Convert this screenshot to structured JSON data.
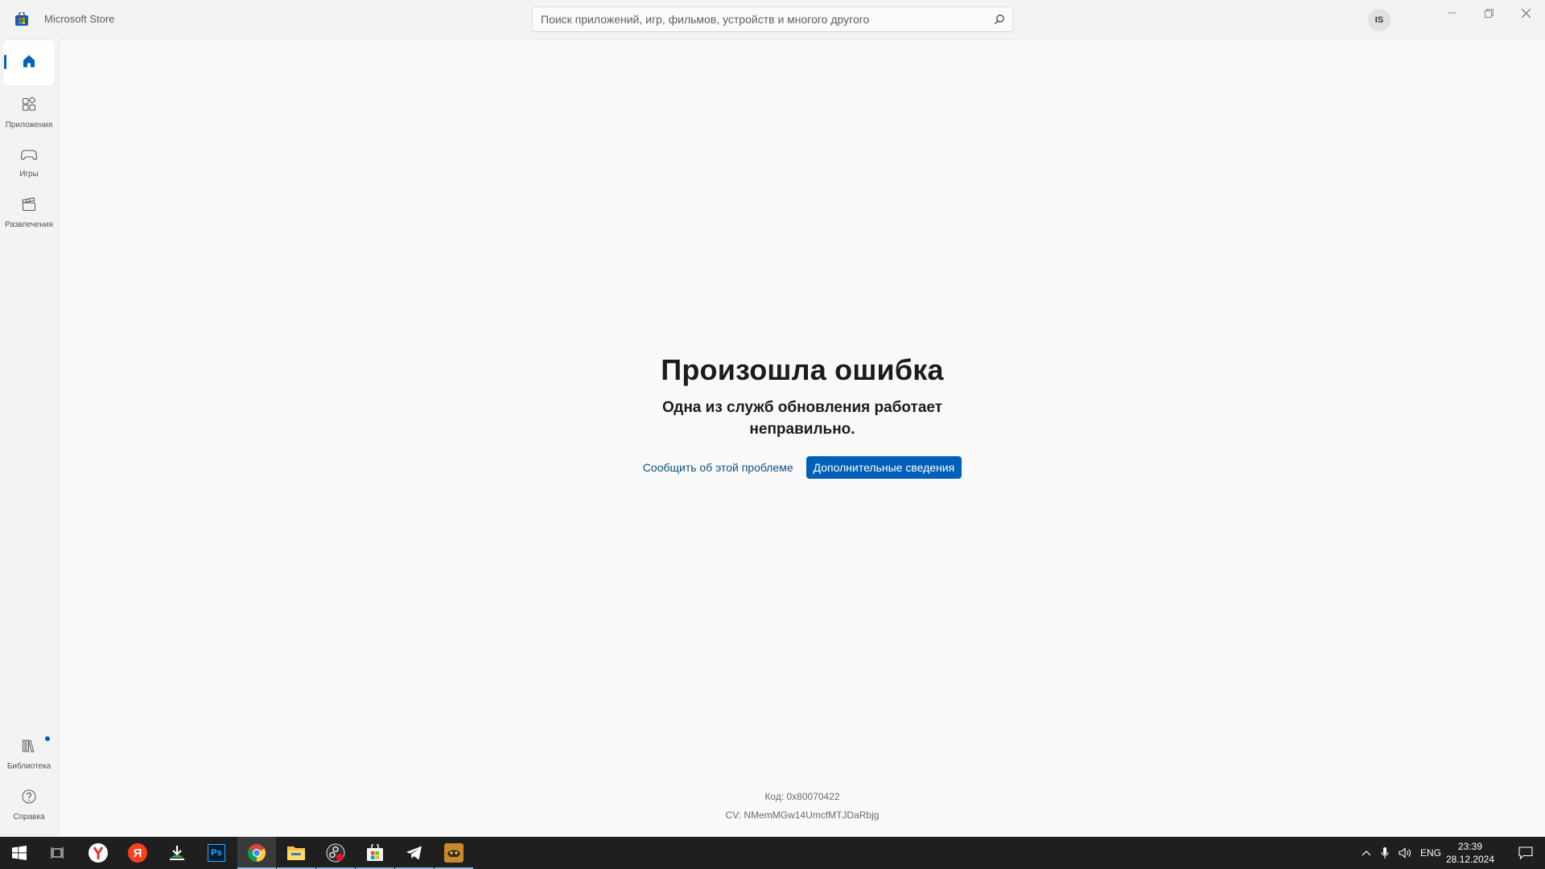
{
  "window": {
    "app_title": "Microsoft Store",
    "avatar_initials": "IS"
  },
  "search": {
    "placeholder": "Поиск приложений, игр, фильмов, устройств и многого другого",
    "value": ""
  },
  "sidebar": {
    "items": [
      {
        "id": "home",
        "label": "",
        "icon": "home-icon",
        "active": true
      },
      {
        "id": "apps",
        "label": "Приложения",
        "icon": "apps-grid-icon"
      },
      {
        "id": "games",
        "label": "Игры",
        "icon": "gamepad-icon"
      },
      {
        "id": "entertainment",
        "label": "Развлечения",
        "icon": "clapperboard-icon"
      }
    ],
    "bottom_items": [
      {
        "id": "library",
        "label": "Библиотека",
        "icon": "library-icon",
        "badge": true
      },
      {
        "id": "help",
        "label": "Справка",
        "icon": "help-icon"
      }
    ]
  },
  "error": {
    "title": "Произошла ошибка",
    "message": "Одна из служб обновления работает неправильно.",
    "report_link": "Сообщить об этой проблеме",
    "details_button": "Дополнительные сведения",
    "code": "Код: 0x80070422",
    "cv": "CV: NMemMGw14UmcfMTJDaRbjg"
  },
  "taskbar": {
    "apps": [
      "start-icon",
      "task-view-icon",
      "yandex-browser-icon",
      "yandex-icon",
      "download-app-icon",
      "photoshop-icon",
      "chrome-icon",
      "file-explorer-icon",
      "obs-icon",
      "microsoft-store-icon",
      "telegram-icon",
      "game-app-icon"
    ],
    "photoshop_label": "Ps",
    "yandex_label": "Я",
    "language": "ENG",
    "time": "23:39",
    "date": "28.12.2024"
  },
  "colors": {
    "accent": "#005fb8",
    "link": "#0f4f84",
    "taskbar": "#1f1f1f",
    "background": "#f3f3f3"
  }
}
